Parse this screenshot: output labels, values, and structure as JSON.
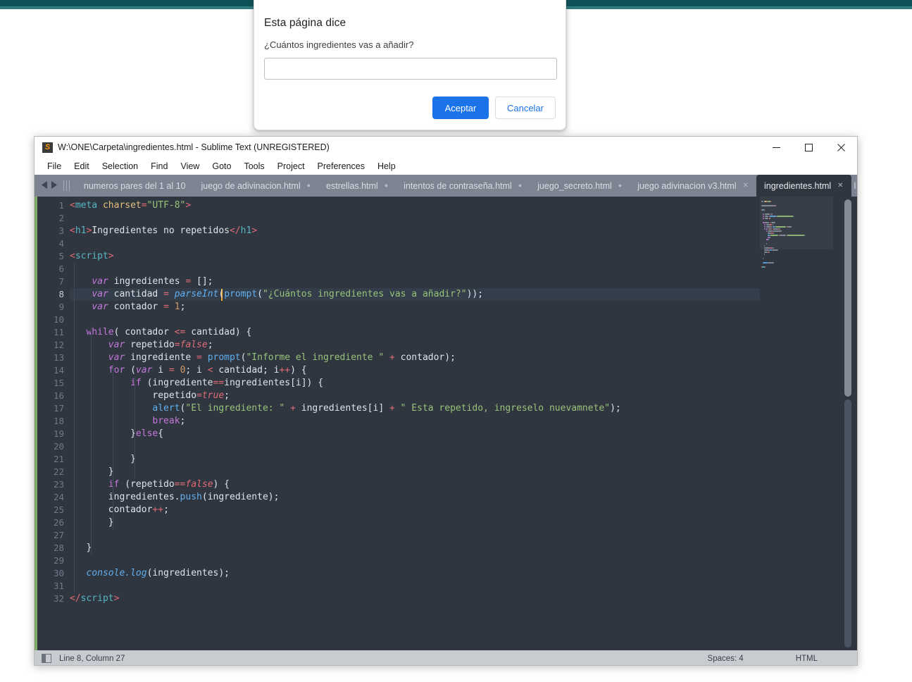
{
  "page": {
    "topbar_color": "#0d5257",
    "topbar_accent_color": "#2f7b7e"
  },
  "dialog": {
    "title": "Esta página dice",
    "message": "¿Cuántos ingredientes vas a añadir?",
    "input_value": "",
    "input_placeholder": "",
    "accept_label": "Aceptar",
    "cancel_label": "Cancelar",
    "accept_color": "#1a73e8",
    "cancel_text_color": "#1a73e8"
  },
  "sublime": {
    "title": "W:\\ONE\\Carpeta\\ingredientes.html - Sublime Text (UNREGISTERED)",
    "app_icon_glyph": "S",
    "window_controls": {
      "minimize": "minimize-icon",
      "maximize": "maximize-icon",
      "close": "close-icon"
    },
    "menu": [
      "File",
      "Edit",
      "Selection",
      "Find",
      "View",
      "Goto",
      "Tools",
      "Project",
      "Preferences",
      "Help"
    ],
    "tabs": [
      {
        "label": "numeros pares del 1 al 10",
        "mark": "none",
        "active": false
      },
      {
        "label": "juego de adivinacion.html",
        "mark": "dot",
        "active": false
      },
      {
        "label": "estrellas.html",
        "mark": "dot",
        "active": false
      },
      {
        "label": "intentos de contraseña.html",
        "mark": "dot",
        "active": false
      },
      {
        "label": "juego_secreto.html",
        "mark": "dot",
        "active": false
      },
      {
        "label": "juego adivinacion v3.html",
        "mark": "x",
        "active": false
      },
      {
        "label": "ingredientes.html",
        "mark": "x",
        "active": true
      }
    ],
    "tab_truncated_label": "l",
    "tab_actions": {
      "new_tab": "+",
      "tab_menu": "▼"
    },
    "statusbar": {
      "position": "Line 8, Column 27",
      "spaces": "Spaces: 4",
      "syntax": "HTML"
    },
    "editor": {
      "cursor_line": 8,
      "total_lines": 32,
      "lines": [
        {
          "n": 1,
          "tokens": [
            {
              "t": "<",
              "c": "t-tag"
            },
            {
              "t": "meta",
              "c": "t-tagname"
            },
            {
              "t": " ",
              "c": "t-plain"
            },
            {
              "t": "charset",
              "c": "t-attr"
            },
            {
              "t": "=",
              "c": "t-tag"
            },
            {
              "t": "\"UTF-8\"",
              "c": "t-str"
            },
            {
              "t": ">",
              "c": "t-tag"
            }
          ]
        },
        {
          "n": 2,
          "tokens": []
        },
        {
          "n": 3,
          "tokens": [
            {
              "t": "<",
              "c": "t-tag"
            },
            {
              "t": "h1",
              "c": "t-tagname"
            },
            {
              "t": ">",
              "c": "t-tag"
            },
            {
              "t": "Ingredientes no repetidos",
              "c": "t-html"
            },
            {
              "t": "</",
              "c": "t-tag"
            },
            {
              "t": "h1",
              "c": "t-tagname"
            },
            {
              "t": ">",
              "c": "t-tag"
            }
          ]
        },
        {
          "n": 4,
          "tokens": []
        },
        {
          "n": 5,
          "tokens": [
            {
              "t": "<",
              "c": "t-tag"
            },
            {
              "t": "script",
              "c": "t-tagname"
            },
            {
              "t": ">",
              "c": "t-tag"
            }
          ]
        },
        {
          "n": 6,
          "tokens": []
        },
        {
          "n": 7,
          "tokens": [
            {
              "t": "    ",
              "c": "t-plain"
            },
            {
              "t": "var",
              "c": "t-kwi"
            },
            {
              "t": " ingredientes ",
              "c": "t-plain"
            },
            {
              "t": "=",
              "c": "t-op"
            },
            {
              "t": " [];",
              "c": "t-plain"
            }
          ]
        },
        {
          "n": 8,
          "tokens": [
            {
              "t": "    ",
              "c": "t-plain"
            },
            {
              "t": "var",
              "c": "t-kwi"
            },
            {
              "t": " cantidad ",
              "c": "t-plain"
            },
            {
              "t": "=",
              "c": "t-op"
            },
            {
              "t": " ",
              "c": "t-plain"
            },
            {
              "t": "parseInt",
              "c": "t-fni"
            },
            {
              "t": "(",
              "c": "t-plain"
            },
            {
              "t": "prompt",
              "c": "t-fn"
            },
            {
              "t": "(",
              "c": "t-plain"
            },
            {
              "t": "\"¿Cuántos ingredientes vas a añadir?\"",
              "c": "t-str"
            },
            {
              "t": "));",
              "c": "t-plain"
            }
          ]
        },
        {
          "n": 9,
          "tokens": [
            {
              "t": "    ",
              "c": "t-plain"
            },
            {
              "t": "var",
              "c": "t-kwi"
            },
            {
              "t": " contador ",
              "c": "t-plain"
            },
            {
              "t": "=",
              "c": "t-op"
            },
            {
              "t": " ",
              "c": "t-plain"
            },
            {
              "t": "1",
              "c": "t-num"
            },
            {
              "t": ";",
              "c": "t-plain"
            }
          ]
        },
        {
          "n": 10,
          "tokens": []
        },
        {
          "n": 11,
          "tokens": [
            {
              "t": "   ",
              "c": "t-plain"
            },
            {
              "t": "while",
              "c": "t-kw"
            },
            {
              "t": "( contador ",
              "c": "t-plain"
            },
            {
              "t": "<=",
              "c": "t-op"
            },
            {
              "t": " cantidad) {",
              "c": "t-plain"
            }
          ]
        },
        {
          "n": 12,
          "tokens": [
            {
              "t": "       ",
              "c": "t-plain"
            },
            {
              "t": "var",
              "c": "t-kwi"
            },
            {
              "t": " repetido",
              "c": "t-plain"
            },
            {
              "t": "=",
              "c": "t-op"
            },
            {
              "t": "false",
              "c": "t-const"
            },
            {
              "t": ";",
              "c": "t-plain"
            }
          ]
        },
        {
          "n": 13,
          "tokens": [
            {
              "t": "       ",
              "c": "t-plain"
            },
            {
              "t": "var",
              "c": "t-kwi"
            },
            {
              "t": " ingrediente ",
              "c": "t-plain"
            },
            {
              "t": "=",
              "c": "t-op"
            },
            {
              "t": " ",
              "c": "t-plain"
            },
            {
              "t": "prompt",
              "c": "t-fn"
            },
            {
              "t": "(",
              "c": "t-plain"
            },
            {
              "t": "\"Informe el ingrediente \"",
              "c": "t-str"
            },
            {
              "t": " ",
              "c": "t-plain"
            },
            {
              "t": "+",
              "c": "t-op"
            },
            {
              "t": " contador);",
              "c": "t-plain"
            }
          ]
        },
        {
          "n": 14,
          "tokens": [
            {
              "t": "       ",
              "c": "t-plain"
            },
            {
              "t": "for",
              "c": "t-kw"
            },
            {
              "t": " (",
              "c": "t-plain"
            },
            {
              "t": "var",
              "c": "t-kwi"
            },
            {
              "t": " i ",
              "c": "t-plain"
            },
            {
              "t": "=",
              "c": "t-op"
            },
            {
              "t": " ",
              "c": "t-plain"
            },
            {
              "t": "0",
              "c": "t-num"
            },
            {
              "t": "; i ",
              "c": "t-plain"
            },
            {
              "t": "<",
              "c": "t-op"
            },
            {
              "t": " cantidad; i",
              "c": "t-plain"
            },
            {
              "t": "++",
              "c": "t-op"
            },
            {
              "t": ") {",
              "c": "t-plain"
            }
          ]
        },
        {
          "n": 15,
          "tokens": [
            {
              "t": "           ",
              "c": "t-plain"
            },
            {
              "t": "if",
              "c": "t-kw"
            },
            {
              "t": " (ingrediente",
              "c": "t-plain"
            },
            {
              "t": "==",
              "c": "t-op"
            },
            {
              "t": "ingredientes[i]) {",
              "c": "t-plain"
            }
          ]
        },
        {
          "n": 16,
          "tokens": [
            {
              "t": "               ",
              "c": "t-plain"
            },
            {
              "t": "repetido",
              "c": "t-plain"
            },
            {
              "t": "=",
              "c": "t-op"
            },
            {
              "t": "true",
              "c": "t-const"
            },
            {
              "t": ";",
              "c": "t-plain"
            }
          ]
        },
        {
          "n": 17,
          "tokens": [
            {
              "t": "               ",
              "c": "t-plain"
            },
            {
              "t": "alert",
              "c": "t-fn"
            },
            {
              "t": "(",
              "c": "t-plain"
            },
            {
              "t": "\"El ingrediente: \"",
              "c": "t-str"
            },
            {
              "t": " ",
              "c": "t-plain"
            },
            {
              "t": "+",
              "c": "t-op"
            },
            {
              "t": " ingredientes[i] ",
              "c": "t-plain"
            },
            {
              "t": "+",
              "c": "t-op"
            },
            {
              "t": " ",
              "c": "t-plain"
            },
            {
              "t": "\" Esta repetido, ingreselo nuevamnete\"",
              "c": "t-str"
            },
            {
              "t": ");",
              "c": "t-plain"
            }
          ]
        },
        {
          "n": 18,
          "tokens": [
            {
              "t": "               ",
              "c": "t-plain"
            },
            {
              "t": "break",
              "c": "t-kw"
            },
            {
              "t": ";",
              "c": "t-plain"
            }
          ]
        },
        {
          "n": 19,
          "tokens": [
            {
              "t": "           }",
              "c": "t-plain"
            },
            {
              "t": "else",
              "c": "t-kw"
            },
            {
              "t": "{",
              "c": "t-plain"
            }
          ]
        },
        {
          "n": 20,
          "tokens": []
        },
        {
          "n": 21,
          "tokens": [
            {
              "t": "           }",
              "c": "t-plain"
            }
          ]
        },
        {
          "n": 22,
          "tokens": [
            {
              "t": "       }",
              "c": "t-plain"
            }
          ]
        },
        {
          "n": 23,
          "tokens": [
            {
              "t": "       ",
              "c": "t-plain"
            },
            {
              "t": "if",
              "c": "t-kw"
            },
            {
              "t": " (repetido",
              "c": "t-plain"
            },
            {
              "t": "==",
              "c": "t-op"
            },
            {
              "t": "false",
              "c": "t-const"
            },
            {
              "t": ") {",
              "c": "t-plain"
            }
          ]
        },
        {
          "n": 24,
          "tokens": [
            {
              "t": "       ingredientes.",
              "c": "t-plain"
            },
            {
              "t": "push",
              "c": "t-fn"
            },
            {
              "t": "(ingrediente);",
              "c": "t-plain"
            }
          ]
        },
        {
          "n": 25,
          "tokens": [
            {
              "t": "       contador",
              "c": "t-plain"
            },
            {
              "t": "++",
              "c": "t-op"
            },
            {
              "t": ";",
              "c": "t-plain"
            }
          ]
        },
        {
          "n": 26,
          "tokens": [
            {
              "t": "       }",
              "c": "t-plain"
            }
          ]
        },
        {
          "n": 27,
          "tokens": []
        },
        {
          "n": 28,
          "tokens": [
            {
              "t": "   }",
              "c": "t-plain"
            }
          ]
        },
        {
          "n": 29,
          "tokens": []
        },
        {
          "n": 30,
          "tokens": [
            {
              "t": "   ",
              "c": "t-plain"
            },
            {
              "t": "console.log",
              "c": "t-fni"
            },
            {
              "t": "(ingredientes);",
              "c": "t-plain"
            }
          ]
        },
        {
          "n": 31,
          "tokens": []
        },
        {
          "n": 32,
          "tokens": [
            {
              "t": "</",
              "c": "t-tag"
            },
            {
              "t": "script",
              "c": "t-tagname"
            },
            {
              "t": ">",
              "c": "t-tag"
            }
          ]
        }
      ]
    }
  }
}
